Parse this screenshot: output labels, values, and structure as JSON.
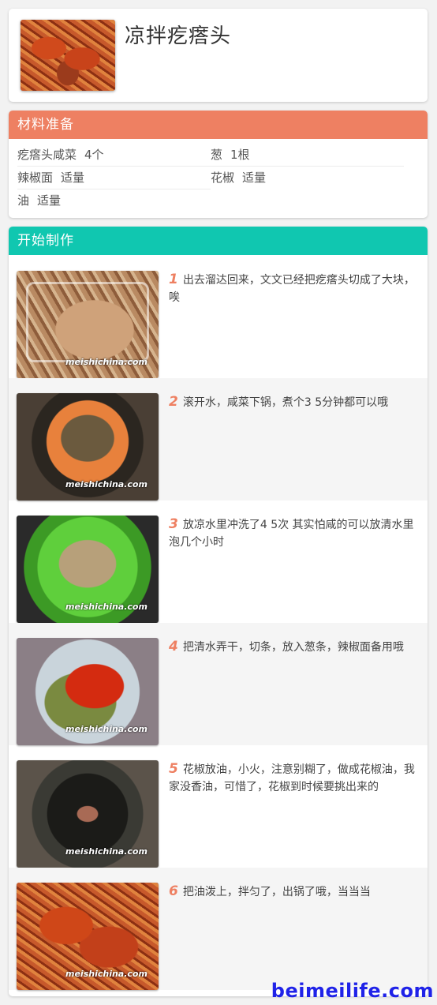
{
  "recipe": {
    "title": "凉拌疙瘩头"
  },
  "ingredients": {
    "header": "材料准备",
    "items": [
      {
        "name": "疙瘩头咸菜",
        "amount": "4个"
      },
      {
        "name": "葱",
        "amount": "1根"
      },
      {
        "name": "辣椒面",
        "amount": "适量"
      },
      {
        "name": "花椒",
        "amount": "适量"
      },
      {
        "name": "油",
        "amount": "适量"
      }
    ]
  },
  "steps": {
    "header": "开始制作",
    "watermark": "meishichina.com",
    "items": [
      {
        "num": "1",
        "text": "出去溜达回来，文文已经把疙瘩头切成了大块，唉"
      },
      {
        "num": "2",
        "text": "滚开水，咸菜下锅，煮个3 5分钟都可以哦"
      },
      {
        "num": "3",
        "text": "放凉水里冲洗了4 5次 其实怕咸的可以放清水里泡几个小时"
      },
      {
        "num": "4",
        "text": "把清水弄干，切条，放入葱条，辣椒面备用哦"
      },
      {
        "num": "5",
        "text": "花椒放油，小火，注意别糊了，做成花椒油，我家没香油，可惜了，花椒到时候要挑出来的"
      },
      {
        "num": "6",
        "text": "把油泼上，拌匀了，出锅了哦，当当当"
      }
    ]
  },
  "brand": "beimeilife.com",
  "colors": {
    "ingredients_header": "#ee8062",
    "steps_header": "#10c7b0",
    "step_number": "#ee8062",
    "brand": "#1f22e8"
  }
}
